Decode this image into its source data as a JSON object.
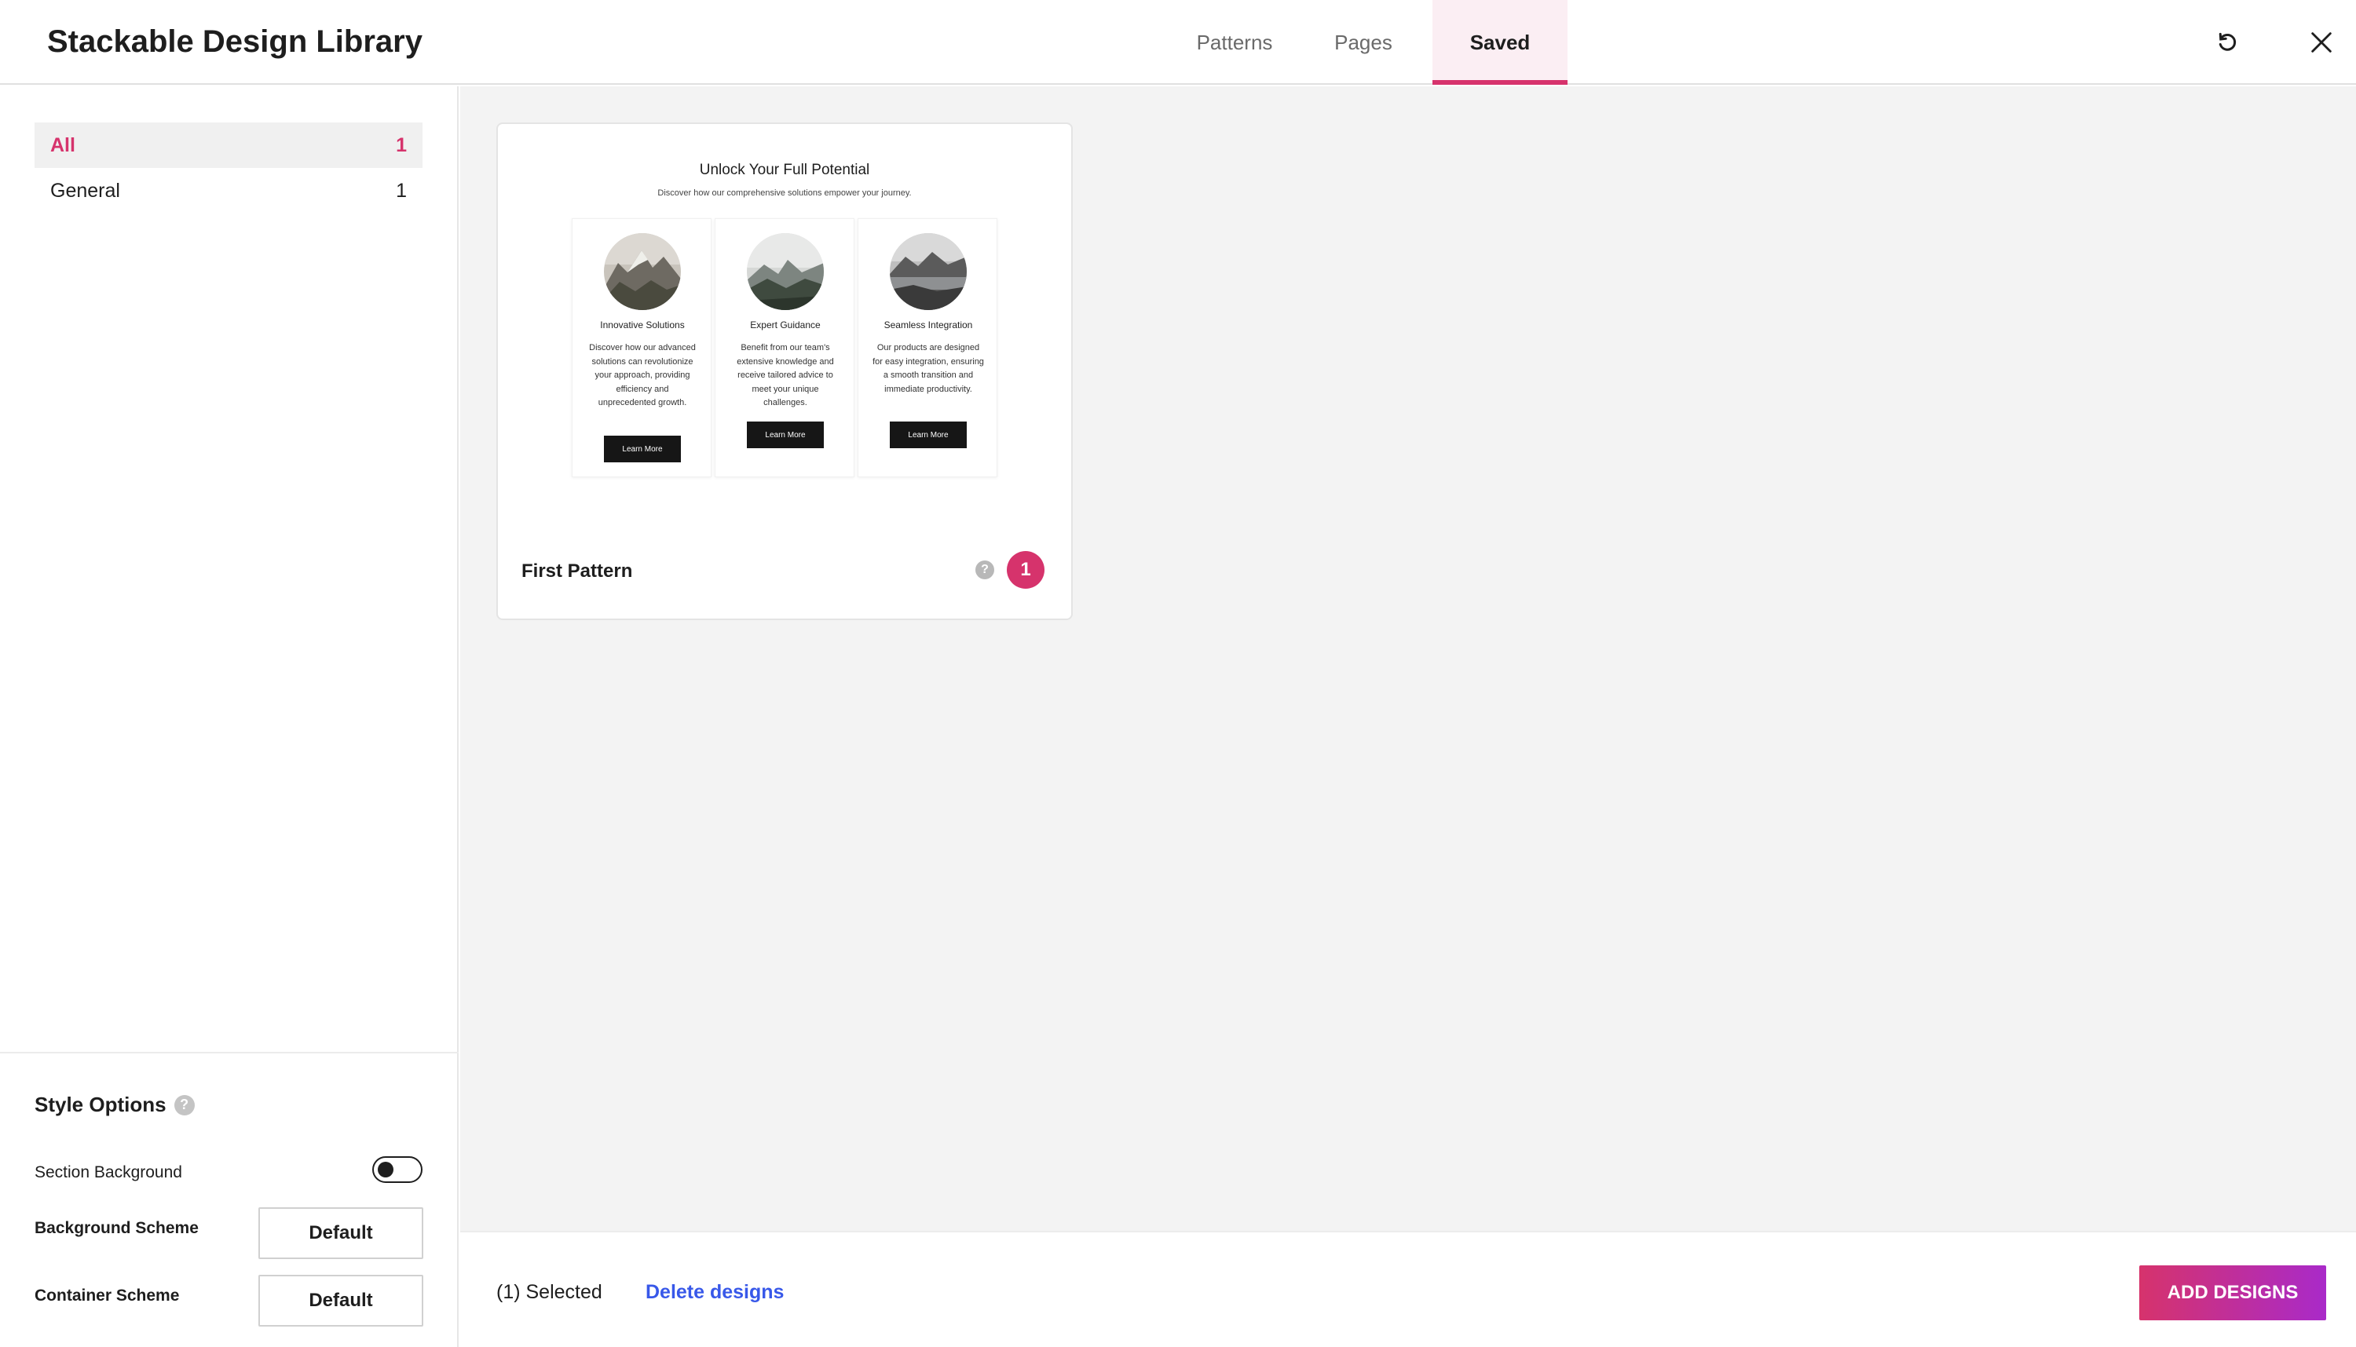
{
  "header": {
    "title": "Stackable Design Library",
    "tabs": [
      {
        "label": "Patterns",
        "active": false
      },
      {
        "label": "Pages",
        "active": false
      },
      {
        "label": "Saved",
        "active": true
      }
    ],
    "icons": {
      "refresh": "refresh-icon",
      "close": "close-icon"
    }
  },
  "sidebar": {
    "categories": [
      {
        "label": "All",
        "count": "1",
        "active": true
      },
      {
        "label": "General",
        "count": "1",
        "active": false
      }
    ],
    "style_options": {
      "title": "Style Options",
      "help": "?",
      "section_background_label": "Section Background",
      "section_background_on": false,
      "background_scheme_label": "Background Scheme",
      "background_scheme_value": "Default",
      "container_scheme_label": "Container Scheme",
      "container_scheme_value": "Default"
    }
  },
  "main": {
    "cards": [
      {
        "name": "First Pattern",
        "help": "?",
        "count": "1",
        "preview": {
          "title": "Unlock Your Full Potential",
          "subtitle": "Discover how our comprehensive solutions empower your journey.",
          "columns": [
            {
              "heading": "Innovative Solutions",
              "text": "Discover how our advanced solutions can revolutionize your approach, providing efficiency and unprecedented growth.",
              "button": "Learn More"
            },
            {
              "heading": "Expert Guidance",
              "text": "Benefit from our team's extensive knowledge and receive tailored advice to meet your unique challenges.",
              "button": "Learn More"
            },
            {
              "heading": "Seamless Integration",
              "text": "Our products are designed for easy integration, ensuring a smooth transition and immediate productivity.",
              "button": "Learn More"
            }
          ]
        }
      }
    ]
  },
  "footer": {
    "selected": "(1) Selected",
    "delete_label": "Delete designs",
    "add_label": "ADD DESIGNS"
  },
  "colors": {
    "accent": "#d6336c",
    "link": "#3858e9",
    "gradient_end": "#a92ac9",
    "panel_bg": "#f3f3f3"
  }
}
